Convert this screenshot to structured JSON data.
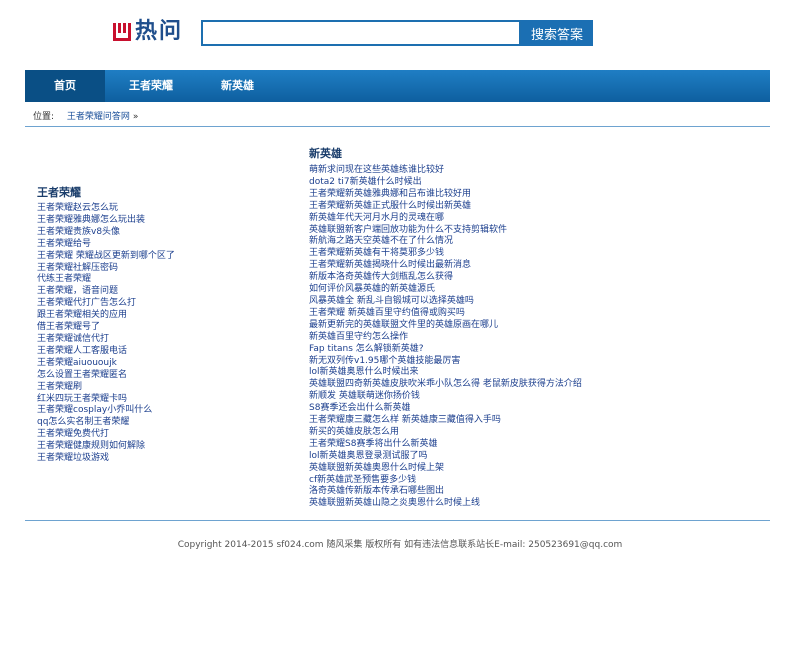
{
  "header": {
    "logo_text": "热问",
    "search_placeholder": "",
    "search_button": "搜索答案"
  },
  "nav": {
    "items": [
      {
        "label": "首页"
      },
      {
        "label": "王者荣耀"
      },
      {
        "label": "新英雄"
      }
    ]
  },
  "breadcrumb": {
    "prefix": "位置:",
    "link": "王者荣耀问答网",
    "separator": "»"
  },
  "left_column": {
    "title": "王者荣耀",
    "links": [
      "王者荣耀赵云怎么玩",
      "王者荣耀雅典娜怎么玩出装",
      "王者荣耀贵族v8头像",
      "王者荣耀给号",
      "王者荣耀 荣耀战区更新到哪个区了",
      "王者荣耀社解压密码",
      "代练王者荣耀",
      "王者荣耀，语音问题",
      "王者荣耀代打广告怎么打",
      "跟王者荣耀相关的应用",
      "借王者荣耀号了",
      "王者荣耀诚信代打",
      "王者荣耀人工客服电话",
      "王者荣耀aiuououjk",
      "怎么设置王者荣耀匿名",
      "王者荣耀刷",
      "红米四玩王者荣耀卡吗",
      "王者荣耀cosplay小乔叫什么",
      "qq怎么实名制王者荣耀",
      "王者荣耀免费代打",
      "王者荣耀健康规则如何解除",
      "王者荣耀垃圾游戏"
    ]
  },
  "right_column": {
    "title": "新英雄",
    "links": [
      "萌新求问现在这些英雄练谁比较好",
      "dota2 ti7新英雄什么时候出",
      "王者荣耀新英雄雅典娜和吕布谁比较好用",
      "王者荣耀新英雄正式服什么时候出新英雄",
      "新英雄年代天河月水月的灵魂在哪",
      "英雄联盟新客户端回放功能为什么不支持剪辑软件",
      "新航海之路天空英雄不在了什么情况",
      "王者荣耀新英雄有干将莫邪多少钱",
      "王者荣耀新英雄揭晓什么时候出最新消息",
      "新版本洛奇英雄传大剑瓶乱怎么获得",
      "如何评价风暴英雄的新英雄源氏",
      "风暴英雄全 新乱斗自锻城可以选择英雄吗",
      "王者荣耀 新英雄百里守约值得或购买吗",
      "最新更新完的英雄联盟文件里的英雄原画在哪儿",
      "新英雄百里守约怎么操作",
      "Fap titans 怎么解锁新英雄?",
      "新无双列传v1.95哪个英雄技能最厉害",
      "lol新英雄奥恩什么时候出来",
      "英雄联盟四奇新英雄皮肤吹米乖小队怎么得 老鼠新皮肤获得方法介绍",
      "新顺发 英雄联萌迷你扬价钱",
      "S8赛季还会出什么新英雄",
      "王者荣耀康三藏怎么样 新英雄康三藏值得入手吗",
      "新买的英雄皮肤怎么用",
      "王者荣耀S8赛季将出什么新英雄",
      "lol新英雄奥恩登录测试服了吗",
      "英雄联盟新英雄奥恩什么时候上架",
      "cf新英雄武圣预售要多少钱",
      "洛奇英雄传新版本传承石哪些图出",
      "英雄联盟新英雄山隐之炎奥恩什么时候上线"
    ]
  },
  "footer": {
    "text": "Copyright 2014-2015 sf024.com 随风采集 版权所有 如有违法信息联系站长E-mail: 250523691@qq.com"
  },
  "colors": {
    "brand_red": "#c8102e",
    "brand_blue": "#1b6fb3",
    "nav_active": "#0a4f85",
    "link": "#1c3f8e"
  }
}
